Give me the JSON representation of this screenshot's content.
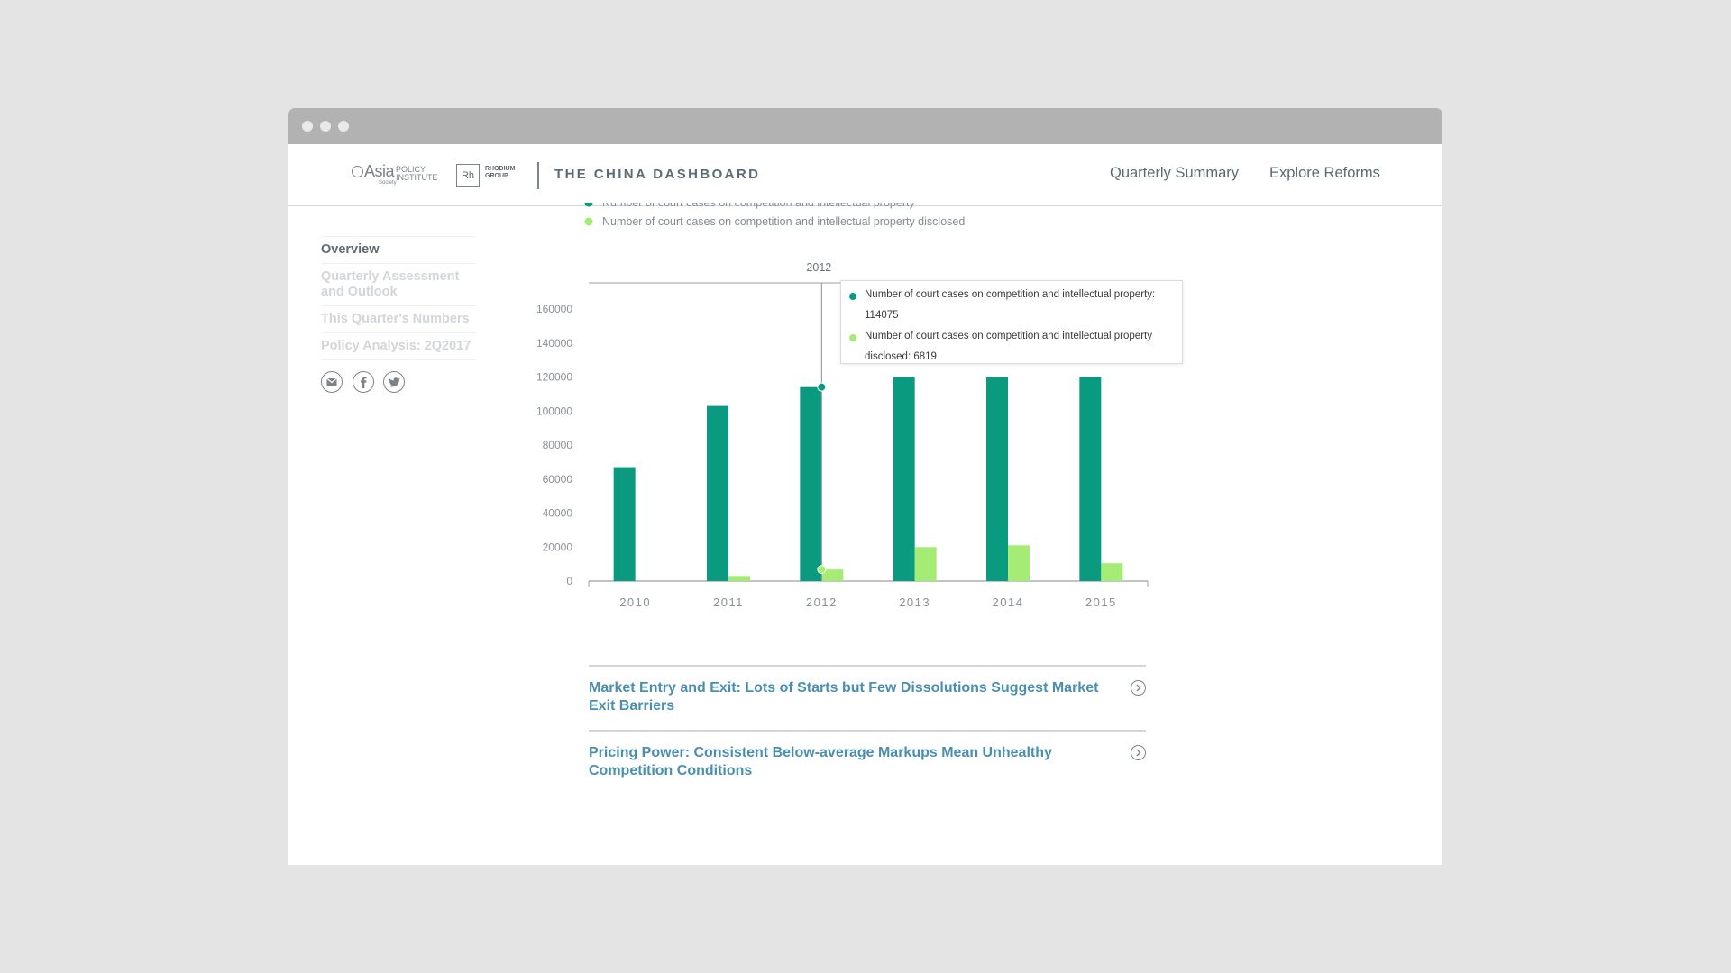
{
  "window": {
    "dots": 3
  },
  "header": {
    "logo_asia": {
      "word": "Asia",
      "policy_line1": "POLICY",
      "policy_line2": "INSTITUTE",
      "society": "Society"
    },
    "logo_rhodium": {
      "mark": "Rh",
      "line1": "RHODIUM",
      "line2": "GROUP"
    },
    "site_title": "THE CHINA DASHBOARD",
    "nav": [
      {
        "label": "Quarterly Summary"
      },
      {
        "label": "Explore Reforms"
      }
    ]
  },
  "sidebar": {
    "items": [
      {
        "label": "Overview",
        "active": true
      },
      {
        "label": "Quarterly Assessment and Outlook",
        "active": false
      },
      {
        "label": "This Quarter's Numbers",
        "active": false
      },
      {
        "label": "Policy Analysis: 2Q2017",
        "active": false
      }
    ],
    "social": [
      "email-icon",
      "facebook-icon",
      "twitter-icon"
    ]
  },
  "chart_data": {
    "type": "bar",
    "categories": [
      "2010",
      "2011",
      "2012",
      "2013",
      "2014",
      "2015"
    ],
    "series": [
      {
        "name": "Number of court cases on competition and intellectual property",
        "color": "#0a9a80",
        "values": [
          67000,
          103000,
          114075,
          120000,
          120000,
          120000
        ]
      },
      {
        "name": "Number of court cases on competition and intellectual property disclosed",
        "color": "#a4ec74",
        "values": [
          0,
          3000,
          6819,
          20000,
          21000,
          10500
        ]
      }
    ],
    "ylim": [
      0,
      160000
    ],
    "yticks": [
      "0",
      "20000",
      "40000",
      "60000",
      "80000",
      "100000",
      "120000",
      "140000",
      "160000"
    ],
    "legend_placement": "top-left",
    "hover_category": "2012",
    "tooltip": {
      "line1": "Number of court cases on competition and intellectual property:",
      "line1_value": "114075",
      "line2": "Number of court cases on competition and intellectual property",
      "line2_value": "disclosed: 6819"
    }
  },
  "articles": [
    {
      "title": "Market Entry and Exit: Lots of Starts but Few Dissolutions Suggest Market Exit Barriers"
    },
    {
      "title": "Pricing Power: Consistent Below-average Markups Mean Unhealthy Competition Conditions"
    }
  ]
}
